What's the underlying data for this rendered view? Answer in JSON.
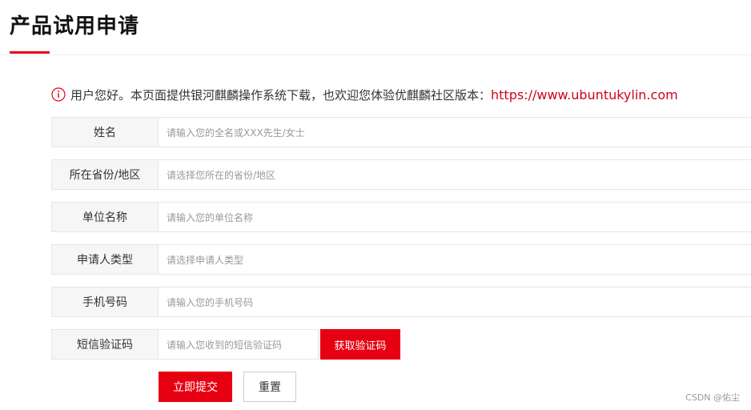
{
  "page_title": "产品试用申请",
  "accent_color": "#e60012",
  "notice": {
    "icon": "info-circle-icon",
    "text": "用户您好。本页面提供银河麒麟操作系统下载，也欢迎您体验优麒麟社区版本：",
    "link": "https://www.ubuntukylin.com"
  },
  "form": {
    "rows": [
      {
        "label": "姓名",
        "placeholder": "请输入您的全名或XXX先生/女士"
      },
      {
        "label": "所在省份/地区",
        "placeholder": "请选择您所在的省份/地区"
      },
      {
        "label": "单位名称",
        "placeholder": "请输入您的单位名称"
      },
      {
        "label": "申请人类型",
        "placeholder": "请选择申请人类型"
      },
      {
        "label": "手机号码",
        "placeholder": "请输入您的手机号码"
      },
      {
        "label": "短信验证码",
        "placeholder": "请输入您收到的短信验证码"
      }
    ],
    "sms_button": "获取验证码",
    "submit_button": "立即提交",
    "reset_button": "重置"
  },
  "watermark": "CSDN @佑尘"
}
